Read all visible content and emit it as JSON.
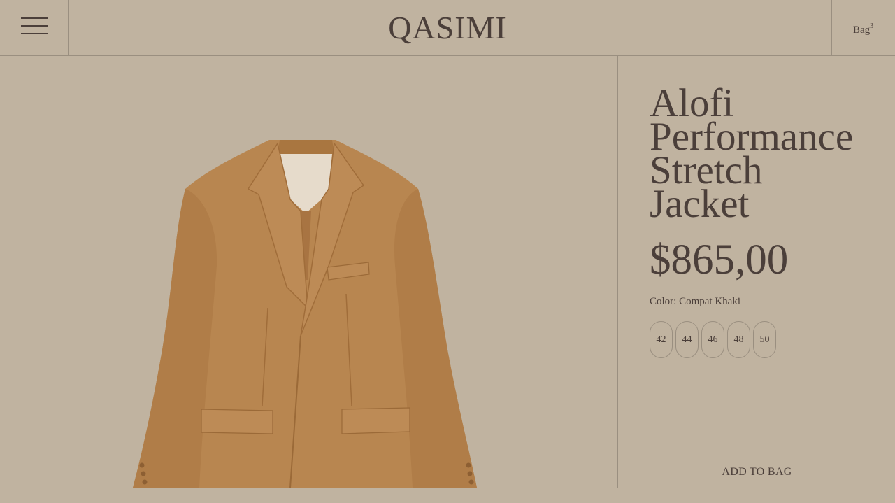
{
  "header": {
    "menu_icon": "hamburger-menu-icon",
    "logo": "QASIMI",
    "bag_label": "Bag",
    "bag_count": "3"
  },
  "product": {
    "image_alt": "jacket-image",
    "title_lines": [
      "Alofi",
      "Performance",
      "Stretch",
      "Jacket"
    ],
    "price": "$865,00",
    "color_label": "Color:",
    "color_value": "Compat Khaki",
    "sizes": [
      "42",
      "44",
      "46",
      "48",
      "50"
    ],
    "add_to_bag": "ADD TO BAG"
  },
  "colors": {
    "background": "#c0b3a0",
    "text": "#4b3f3a",
    "divider": "#9a8f80",
    "jacket": "#b88650"
  }
}
